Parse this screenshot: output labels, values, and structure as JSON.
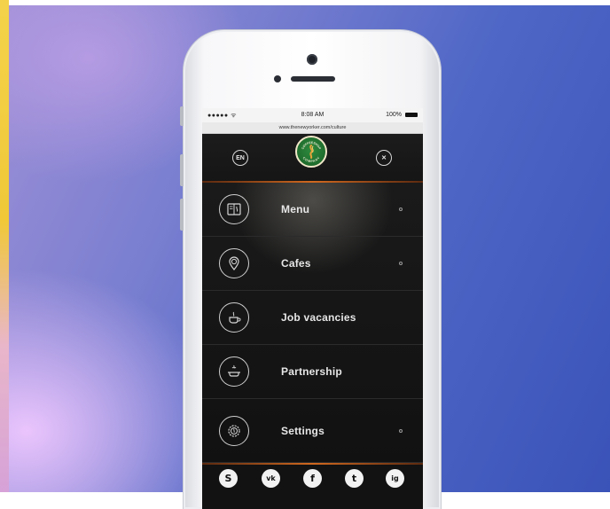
{
  "browser": {
    "signal": "●●●●● ᯤ",
    "time": "8:08 AM",
    "battery": "100%",
    "url": "www.thenewyorker.com/culture"
  },
  "header": {
    "lang_label": "EN",
    "close_label": "✕",
    "logo_text_top": "COFFEESHOP",
    "logo_text_bottom": "COMPANY"
  },
  "menu": {
    "items": [
      {
        "label": "Menu",
        "icon": "menu-book-icon",
        "has_dot": true
      },
      {
        "label": "Cafes",
        "icon": "location-pin-icon",
        "has_dot": true
      },
      {
        "label": "Job vacancies",
        "icon": "cup-icon",
        "has_dot": false
      },
      {
        "label": "Partnership",
        "icon": "handshake-cup-icon",
        "has_dot": false
      },
      {
        "label": "Settings",
        "icon": "gear-icon",
        "has_dot": true
      }
    ]
  },
  "social": {
    "items": [
      "S",
      "vk",
      "f",
      "t",
      "ig"
    ]
  },
  "colors": {
    "accent_orange": "#d0681f",
    "logo_green": "#1f6c2d",
    "menu_bg": "#141414",
    "backdrop_blue": "#3a53b8"
  }
}
